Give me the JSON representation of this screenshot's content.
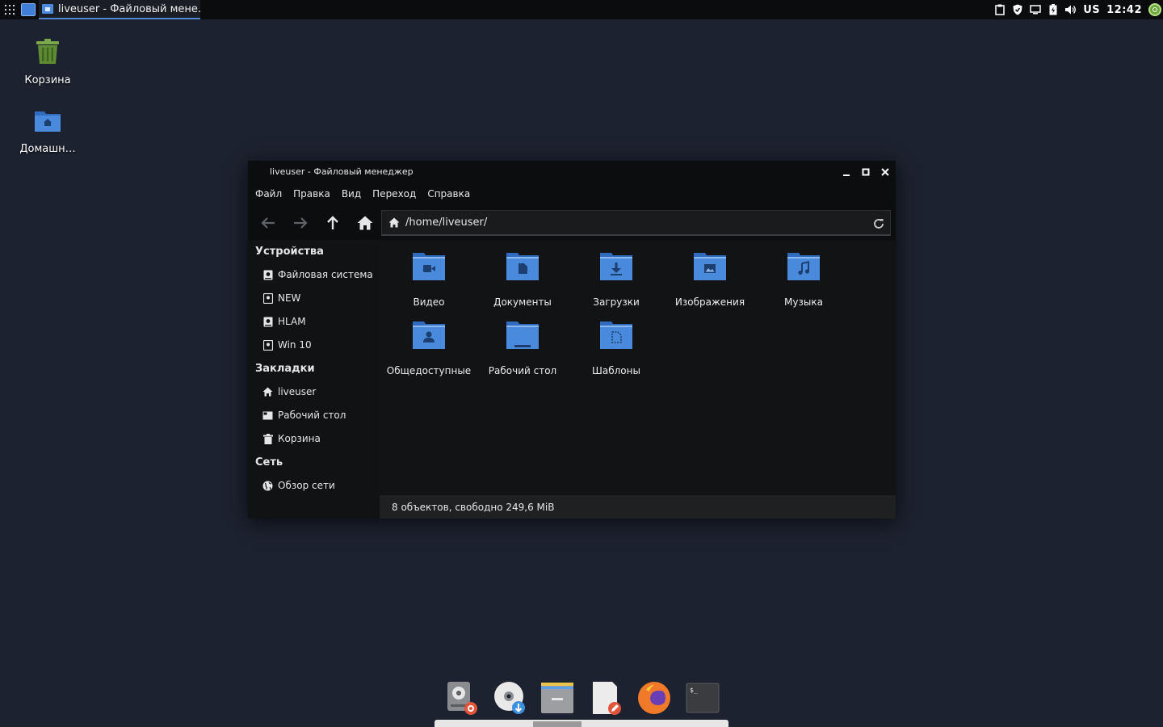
{
  "panel": {
    "task_title": "liveuser - Файловый мене…",
    "keyboard_layout": "US",
    "clock": "12:42",
    "tray_icons": [
      "clipboard-icon",
      "shield-icon",
      "monitor-icon",
      "battery-icon",
      "volume-icon"
    ]
  },
  "desktop": {
    "icons": [
      {
        "label": "Корзина",
        "icon": "trash-icon"
      },
      {
        "label": "Домашн…",
        "icon": "home-folder-icon"
      }
    ]
  },
  "window": {
    "title": "liveuser - Файловый менеджер",
    "menu": [
      "Файл",
      "Правка",
      "Вид",
      "Переход",
      "Справка"
    ],
    "location": "/home/liveuser/",
    "sidebar": {
      "devices_heading": "Устройства",
      "devices": [
        "Файловая система",
        "NEW",
        "HLAM",
        "Win 10"
      ],
      "bookmarks_heading": "Закладки",
      "bookmarks": [
        "liveuser",
        "Рабочий стол",
        "Корзина"
      ],
      "network_heading": "Сеть",
      "network": [
        "Обзор сети"
      ]
    },
    "files": [
      {
        "name": "Видео",
        "icon": "video-folder-icon"
      },
      {
        "name": "Документы",
        "icon": "documents-folder-icon"
      },
      {
        "name": "Загрузки",
        "icon": "downloads-folder-icon"
      },
      {
        "name": "Изображения",
        "icon": "pictures-folder-icon"
      },
      {
        "name": "Музыка",
        "icon": "music-folder-icon"
      },
      {
        "name": "Общедоступные",
        "icon": "public-folder-icon"
      },
      {
        "name": "Рабочий стол",
        "icon": "desktop-folder-icon"
      },
      {
        "name": "Шаблоны",
        "icon": "templates-folder-icon"
      }
    ],
    "status": "8 объектов, свободно 249,6 MiB"
  },
  "dock": {
    "items": [
      "disk-settings-icon",
      "disc-installer-icon",
      "file-manager-icon",
      "text-editor-icon",
      "firefox-icon",
      "terminal-icon"
    ]
  },
  "colors": {
    "desktop_bg": "#1d2230",
    "folder_blue": "#4a8adc",
    "folder_light": "#8cb6ee",
    "accent": "#4f86d4"
  }
}
